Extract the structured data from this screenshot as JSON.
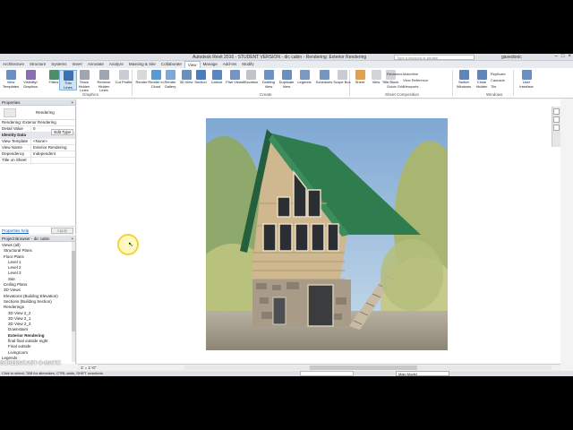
{
  "window": {
    "title": "Autodesk Revit 2016 - STUDENT VERSION -   dic cabin - Rendering: Exterior Rendering",
    "search_placeholder": "Type a keyword or phrase",
    "user": "gavedonic",
    "controls": [
      "–",
      "□",
      "×"
    ]
  },
  "tabs": [
    "Architecture",
    "Structure",
    "Systems",
    "Insert",
    "Annotate",
    "Analyze",
    "Massing & Site",
    "Collaborate",
    "View",
    "Manage",
    "Add-Ins",
    "Modify"
  ],
  "active_tab": "View",
  "ribbon": {
    "buttons": [
      {
        "label": "View Templates",
        "icon": "view-templates-icon",
        "color": "#6a8fc7"
      },
      {
        "label": "Visibility/ Graphics",
        "icon": "visibility-graphics-icon",
        "color": "#8a6fb0"
      },
      {
        "label": "Filters",
        "icon": "filters-icon",
        "color": "#4e8f6a"
      },
      {
        "label": "Thin Lines",
        "icon": "thin-lines-icon",
        "color": "#3c6fb4"
      },
      {
        "label": "Show Hidden Lines",
        "icon": "show-hidden-lines-icon",
        "color": "#a0a6b0"
      },
      {
        "label": "Remove Hidden Lines",
        "icon": "remove-hidden-lines-icon",
        "color": "#a0a6b0"
      },
      {
        "label": "Cut Profile",
        "icon": "cut-profile-icon",
        "color": "#c9ccd2"
      },
      {
        "label": "Render",
        "icon": "render-icon",
        "color": "#d9d9d9"
      },
      {
        "label": "Render in Cloud",
        "icon": "render-cloud-icon",
        "color": "#5b9bd5"
      },
      {
        "label": "Render Gallery",
        "icon": "render-gallery-icon",
        "color": "#7fa7d8"
      },
      {
        "label": "3D View",
        "icon": "3d-view-icon",
        "color": "#6c8fb9"
      },
      {
        "label": "Section",
        "icon": "section-icon",
        "color": "#4a7cc0"
      },
      {
        "label": "Callout",
        "icon": "callout-icon",
        "color": "#5a86c2"
      },
      {
        "label": "Plan Views",
        "icon": "plan-views-icon",
        "color": "#7395c4"
      },
      {
        "label": "Elevation",
        "icon": "elevation-icon",
        "color": "#c0c4ca"
      },
      {
        "label": "Drafting View",
        "icon": "drafting-view-icon",
        "color": "#6d93c6"
      },
      {
        "label": "Duplicate View",
        "icon": "duplicate-view-icon",
        "color": "#6b8fbd"
      },
      {
        "label": "Legends",
        "icon": "legends-icon",
        "color": "#7d99c3"
      },
      {
        "label": "Schedules",
        "icon": "schedules-icon",
        "color": "#7795c0"
      },
      {
        "label": "Scope Box",
        "icon": "scope-box-icon",
        "color": "#c9ccd2"
      },
      {
        "label": "Sheet",
        "icon": "sheet-icon",
        "color": "#e3a04a"
      },
      {
        "label": "View",
        "icon": "view-icon",
        "color": "#d1d4d9"
      },
      {
        "label": "Title Block",
        "icon": "title-block-icon",
        "color": "#d1d4d9"
      },
      {
        "label": "Revisions",
        "icon": "revisions-icon",
        "color": "#6d9fd2"
      },
      {
        "label": "Guide Grid",
        "icon": "guide-grid-icon",
        "color": "#d1d4d9"
      },
      {
        "label": "Switch Windows",
        "icon": "switch-windows-icon",
        "color": "#5e86bd"
      },
      {
        "label": "Close Hidden",
        "icon": "close-hidden-icon",
        "color": "#5e86bd"
      },
      {
        "label": "User Interface",
        "icon": "user-interface-icon",
        "color": "#6a8ec1"
      }
    ],
    "small_items": {
      "matchline": "Matchline",
      "view_reference": "View Reference",
      "viewports": "Viewports",
      "replicate": "Replicate",
      "cascade": "Cascade",
      "tile": "Tile"
    },
    "groups": [
      "Graphics",
      "Create",
      "Sheet Composition",
      "Windows"
    ]
  },
  "properties": {
    "header": "Properties",
    "type_label": "Rendering",
    "view_selector": "Rendering: Exterior Rendering",
    "edit_type": "Edit Type",
    "rows": [
      {
        "k": "Detail Value",
        "v": "0",
        "section": false
      },
      {
        "k": "Identity Data",
        "v": "",
        "section": true
      },
      {
        "k": "View Template",
        "v": "<None>",
        "section": false
      },
      {
        "k": "View Name",
        "v": "Exterior Rendering",
        "section": false
      },
      {
        "k": "Dependency",
        "v": "Independent",
        "section": false
      },
      {
        "k": "Title on Sheet",
        "v": "",
        "section": false
      }
    ],
    "help_link": "Properties help",
    "apply": "Apply"
  },
  "browser": {
    "header": "Project Browser - dic cabin",
    "nodes": [
      {
        "t": "Views (all)",
        "bold": false
      },
      {
        "t": "Structural Plans",
        "bold": false
      },
      {
        "t": "Floor Plans",
        "bold": false
      },
      {
        "t": "Level 1",
        "bold": false
      },
      {
        "t": "Level 2",
        "bold": false
      },
      {
        "t": "Level 3",
        "bold": false
      },
      {
        "t": "Site",
        "bold": false
      },
      {
        "t": "Ceiling Plans",
        "bold": false
      },
      {
        "t": "3D Views",
        "bold": false
      },
      {
        "t": "Elevations (Building Elevation)",
        "bold": false
      },
      {
        "t": "Sections (Building Section)",
        "bold": false
      },
      {
        "t": "Renderings",
        "bold": false
      },
      {
        "t": "3D View 2_2",
        "bold": false
      },
      {
        "t": "3D View 2_1",
        "bold": false
      },
      {
        "t": "3D View 2_3",
        "bold": false
      },
      {
        "t": "Downstairs",
        "bold": false
      },
      {
        "t": "Exterior Rendering",
        "bold": true
      },
      {
        "t": "final final outside night",
        "bold": false
      },
      {
        "t": "Final outside",
        "bold": false
      },
      {
        "t": "Livingroom",
        "bold": false
      },
      {
        "t": "Legends",
        "bold": false
      }
    ]
  },
  "viewbar": {
    "scale": "1' = 1'-0\""
  },
  "status": {
    "message": "Click to select, TAB for alternates, CTRL adds, SHIFT unselects.",
    "model": "Main Model"
  },
  "watermark": "SCREENCAST-O-MATIC",
  "colors": {
    "accent": "#cfe3f7",
    "roof": "#2f7d4f",
    "sky": "#8fb6dc"
  }
}
